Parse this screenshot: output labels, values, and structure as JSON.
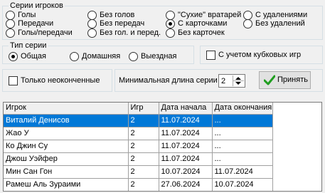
{
  "series_group": {
    "legend": "Серии игроков",
    "options": [
      {
        "label": "Голы",
        "checked": false
      },
      {
        "label": "Передачи",
        "checked": false
      },
      {
        "label": "Голы/передачи",
        "checked": false
      },
      {
        "label": "Без голов",
        "checked": false
      },
      {
        "label": "Без передач",
        "checked": false
      },
      {
        "label": "Без гол. и перед.",
        "checked": false
      },
      {
        "label": "\"Сухие\" вратарей",
        "checked": false
      },
      {
        "label": "С карточками",
        "checked": true
      },
      {
        "label": "Без карточек",
        "checked": false
      },
      {
        "label": "С удалениями",
        "checked": false
      },
      {
        "label": "Без удалений",
        "checked": false
      }
    ]
  },
  "series_type": {
    "legend": "Тип серии",
    "options": [
      {
        "label": "Общая",
        "checked": true
      },
      {
        "label": "Домашняя",
        "checked": false
      },
      {
        "label": "Выездная",
        "checked": false
      }
    ]
  },
  "cup_games_checkbox": {
    "label": "С учетом кубковых игр",
    "checked": false
  },
  "unfinished_checkbox": {
    "label": "Только неоконченные",
    "checked": false
  },
  "min_length": {
    "label": "Минимальная длина серии",
    "value": "2"
  },
  "accept_button": {
    "label": "Принять"
  },
  "grid": {
    "columns": [
      "Игрок",
      "Игр",
      "Дата начала",
      "Дата окончания"
    ],
    "rows": [
      {
        "player": "Виталий Денисов",
        "games": "2",
        "start": "11.07.2024",
        "end": "...",
        "selected": true
      },
      {
        "player": "Жао У",
        "games": "2",
        "start": "11.07.2024",
        "end": "...",
        "selected": false
      },
      {
        "player": "Ко Джин Су",
        "games": "2",
        "start": "11.07.2024",
        "end": "...",
        "selected": false
      },
      {
        "player": "Джош Уэйфер",
        "games": "2",
        "start": "11.07.2024",
        "end": "...",
        "selected": false
      },
      {
        "player": "Мин Сан Гон",
        "games": "2",
        "start": "10.07.2024",
        "end": "11.07.2024",
        "selected": false
      },
      {
        "player": "Рамеш Аль Зураими",
        "games": "2",
        "start": "27.06.2024",
        "end": "10.07.2024",
        "selected": false
      }
    ]
  }
}
